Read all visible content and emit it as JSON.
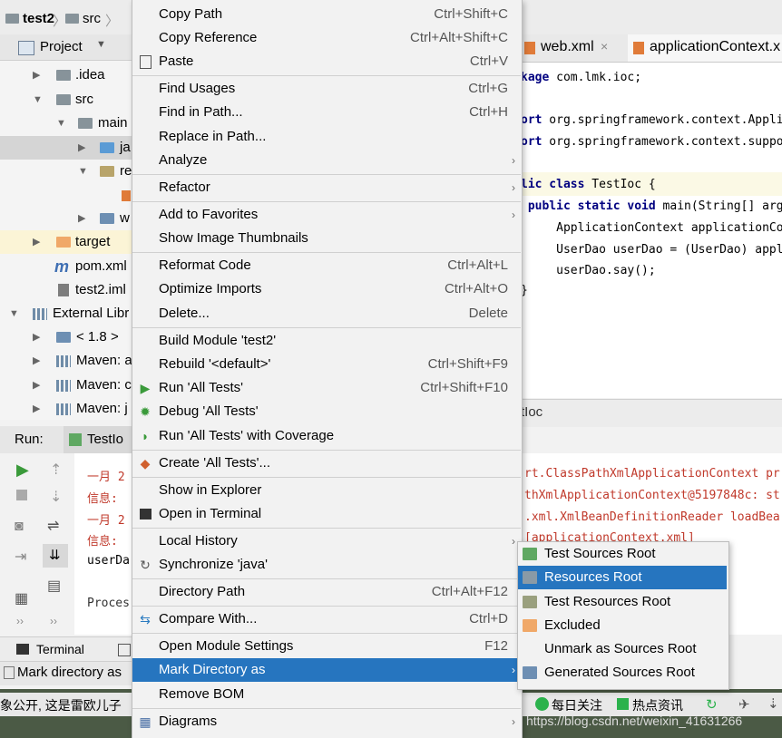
{
  "breadcrumb": {
    "project": "test2",
    "folder": "src"
  },
  "project_panel": {
    "title": "Project",
    "tree": [
      {
        "label": ".idea"
      },
      {
        "label": "src"
      },
      {
        "label": "main"
      },
      {
        "label": "ja"
      },
      {
        "label": "re"
      },
      {
        "label": "w"
      },
      {
        "label": "target"
      },
      {
        "label": "pom.xml"
      },
      {
        "label": "test2.iml"
      },
      {
        "label": "External Libr"
      },
      {
        "label": "< 1.8 >"
      },
      {
        "label": "Maven: a"
      },
      {
        "label": "Maven: c"
      },
      {
        "label": "Maven: j"
      }
    ]
  },
  "editor": {
    "tabs": [
      {
        "label": "web.xml"
      },
      {
        "label": "applicationContext.x"
      }
    ],
    "code": [
      "kage com.lmk.ioc;",
      "",
      "ort org.springframework.context.Appli",
      "ort org.springframework.context.suppo",
      "",
      "lic class TestIoc {",
      " public static void main(String[] arg",
      "     ApplicationContext applicationCo",
      "     UserDao userDao = (UserDao) appl",
      "     userDao.say();",
      "",
      "}"
    ],
    "bottom_tab": "tIoc"
  },
  "run_panel": {
    "label": "Run:",
    "tab": "TestIo",
    "console_left": [
      "一月 2",
      "信息: ",
      "一月 2",
      "信息: ",
      "userDa",
      "",
      "Proces"
    ],
    "console_right": [
      "rt.ClassPathXmlApplicationContext pr",
      "thXmlApplicationContext@5197848c: st",
      ".xml.XmlBeanDefinitionReader loadBea",
      "[applicationContext.xml]"
    ]
  },
  "bottom_bar": {
    "terminal": "Terminal",
    "status": "Mark directory as"
  },
  "context_menu": {
    "items": [
      {
        "label": "Copy Path",
        "shortcut": "Ctrl+Shift+C"
      },
      {
        "label": "Copy Reference",
        "shortcut": "Ctrl+Alt+Shift+C"
      },
      {
        "label": "Paste",
        "shortcut": "Ctrl+V",
        "icon": "paste-icon"
      },
      {
        "label": "Find Usages",
        "shortcut": "Ctrl+G"
      },
      {
        "label": "Find in Path...",
        "shortcut": "Ctrl+H"
      },
      {
        "label": "Replace in Path...",
        "shortcut": ""
      },
      {
        "label": "Analyze",
        "shortcut": "",
        "submenu": true
      },
      {
        "label": "Refactor",
        "shortcut": "",
        "submenu": true
      },
      {
        "label": "Add to Favorites",
        "shortcut": "",
        "submenu": true
      },
      {
        "label": "Show Image Thumbnails",
        "shortcut": ""
      },
      {
        "label": "Reformat Code",
        "shortcut": "Ctrl+Alt+L"
      },
      {
        "label": "Optimize Imports",
        "shortcut": "Ctrl+Alt+O"
      },
      {
        "label": "Delete...",
        "shortcut": "Delete"
      },
      {
        "label": "Build Module 'test2'",
        "shortcut": ""
      },
      {
        "label": "Rebuild '<default>'",
        "shortcut": "Ctrl+Shift+F9"
      },
      {
        "label": "Run 'All Tests'",
        "shortcut": "Ctrl+Shift+F10",
        "icon": "run-icon"
      },
      {
        "label": "Debug 'All Tests'",
        "shortcut": "",
        "icon": "debug-icon"
      },
      {
        "label": "Run 'All Tests' with Coverage",
        "shortcut": "",
        "icon": "coverage-icon"
      },
      {
        "label": "Create 'All Tests'...",
        "shortcut": "",
        "icon": "create-test-icon"
      },
      {
        "label": "Show in Explorer",
        "shortcut": ""
      },
      {
        "label": "Open in Terminal",
        "shortcut": "",
        "icon": "terminal-icon"
      },
      {
        "label": "Local History",
        "shortcut": "",
        "submenu": true
      },
      {
        "label": "Synchronize 'java'",
        "shortcut": "",
        "icon": "sync-icon"
      },
      {
        "label": "Directory Path",
        "shortcut": "Ctrl+Alt+F12"
      },
      {
        "label": "Compare With...",
        "shortcut": "Ctrl+D",
        "icon": "compare-icon"
      },
      {
        "label": "Open Module Settings",
        "shortcut": "F12"
      },
      {
        "label": "Mark Directory as",
        "shortcut": "",
        "submenu": true
      },
      {
        "label": "Remove BOM",
        "shortcut": ""
      },
      {
        "label": "Diagrams",
        "shortcut": "",
        "submenu": true,
        "icon": "diagrams-icon"
      }
    ]
  },
  "submenu": {
    "items": [
      {
        "label": "Test Sources Root",
        "color": "#5fa862"
      },
      {
        "label": "Resources Root",
        "color": "#8a9aa6"
      },
      {
        "label": "Test Resources Root",
        "color": "#9aa07e"
      },
      {
        "label": "Excluded",
        "color": "#f0a868"
      },
      {
        "label": "Unmark as Sources Root",
        "color": ""
      },
      {
        "label": "Generated Sources Root",
        "color": "#6e8fb3"
      }
    ]
  },
  "taskbar": {
    "left_text": "象公开, 这是雷欧儿子",
    "hot1": "每日关注",
    "hot2": "热点资讯",
    "watermark": "https://blog.csdn.net/weixin_41631266"
  },
  "colors": {
    "highlight": "#2675bf",
    "menu_bg": "#f2f2f2"
  }
}
